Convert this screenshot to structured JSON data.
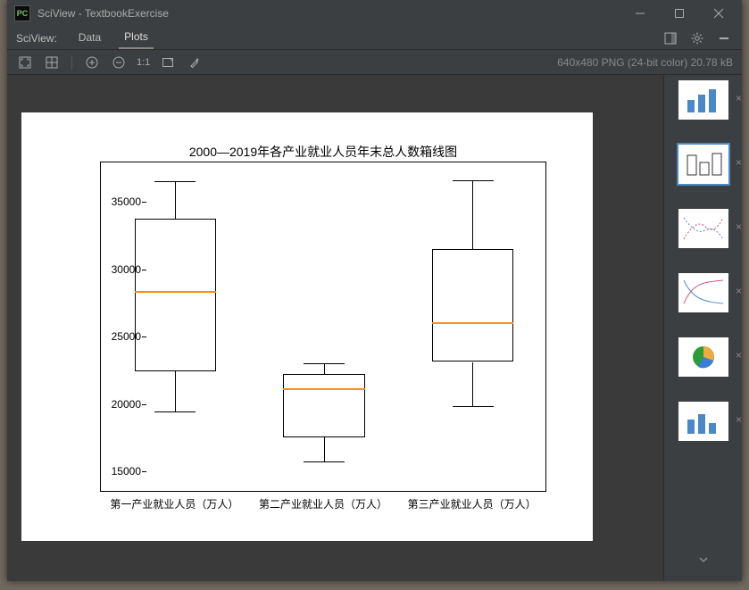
{
  "window": {
    "title": "SciView - TextbookExercise",
    "app_icon_text": "PC"
  },
  "menubar": {
    "label": "SciView:",
    "tabs": [
      {
        "label": "Data",
        "active": false
      },
      {
        "label": "Plots",
        "active": true
      }
    ]
  },
  "toolbar": {
    "status": "640x480 PNG (24-bit color) 20.78 kB",
    "zoom_label": "1:1"
  },
  "chart_data": {
    "type": "boxplot",
    "title": "2000—2019年各产业就业人员年末总人数箱线图",
    "ylabel": "",
    "xlabel": "",
    "ylim": [
      13500,
      38000
    ],
    "yticks": [
      15000,
      20000,
      25000,
      30000,
      35000
    ],
    "categories": [
      "第一产业就业人员（万人）",
      "第二产业就业人员（万人）",
      "第三产业就业人员（万人）"
    ],
    "series": [
      {
        "name": "第一产业就业人员（万人）",
        "min": 19500,
        "q1": 22500,
        "median": 28400,
        "q3": 33800,
        "max": 36600
      },
      {
        "name": "第二产业就业人员（万人）",
        "min": 15800,
        "q1": 17600,
        "median": 21200,
        "q3": 22300,
        "max": 23100
      },
      {
        "name": "第三产业就业人员（万人）",
        "min": 19900,
        "q1": 23200,
        "median": 26100,
        "q3": 31600,
        "max": 36700
      }
    ]
  },
  "thumbnails": {
    "count": 6,
    "selected_index": 1
  }
}
